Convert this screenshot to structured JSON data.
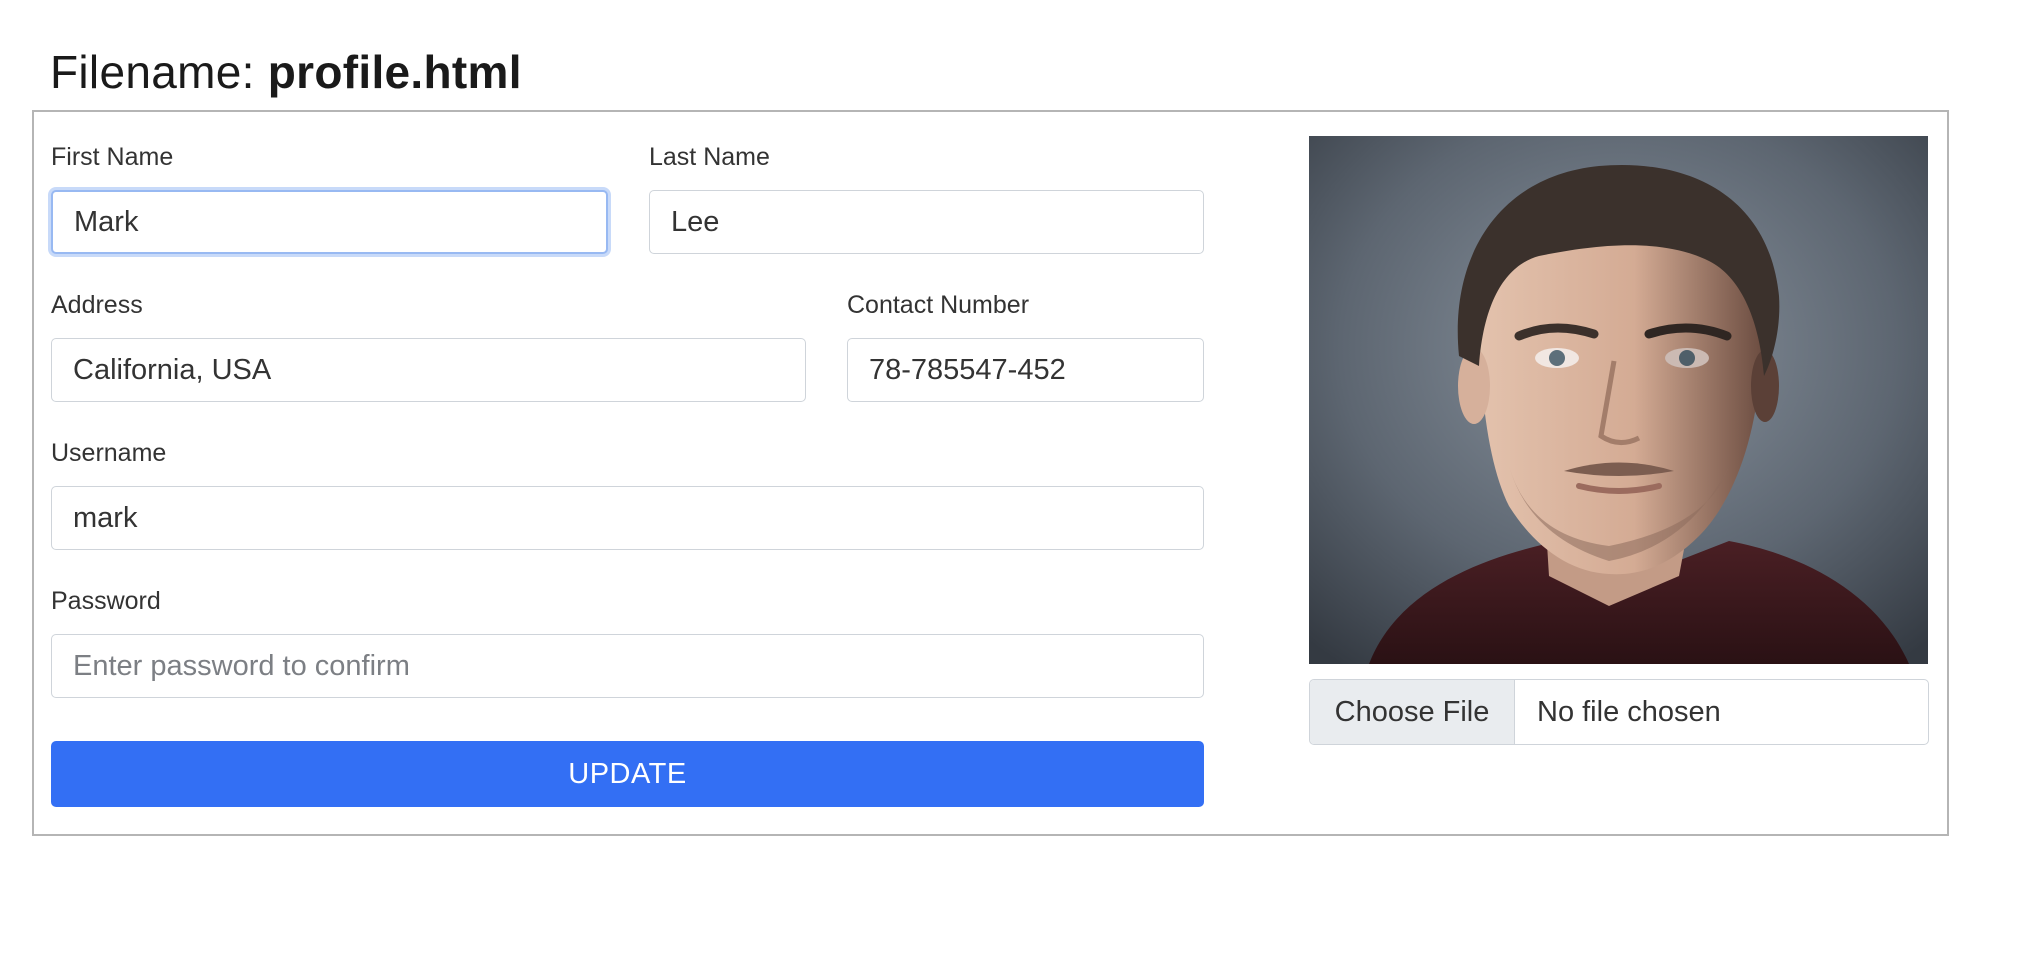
{
  "header": {
    "prefix": "Filename: ",
    "filename": "profile.html"
  },
  "form": {
    "first_name": {
      "label": "First Name",
      "value": "Mark"
    },
    "last_name": {
      "label": "Last Name",
      "value": "Lee"
    },
    "address": {
      "label": "Address",
      "value": "California, USA"
    },
    "contact": {
      "label": "Contact Number",
      "value": "78-785547-452"
    },
    "username": {
      "label": "Username",
      "value": "mark"
    },
    "password": {
      "label": "Password",
      "value": "",
      "placeholder": "Enter password to confirm"
    },
    "update_label": "UPDATE"
  },
  "file_upload": {
    "button_label": "Choose File",
    "status": "No file chosen"
  },
  "colors": {
    "primary": "#336ff4",
    "input_border": "#cfd4da",
    "focus_border": "#98b9f2"
  }
}
